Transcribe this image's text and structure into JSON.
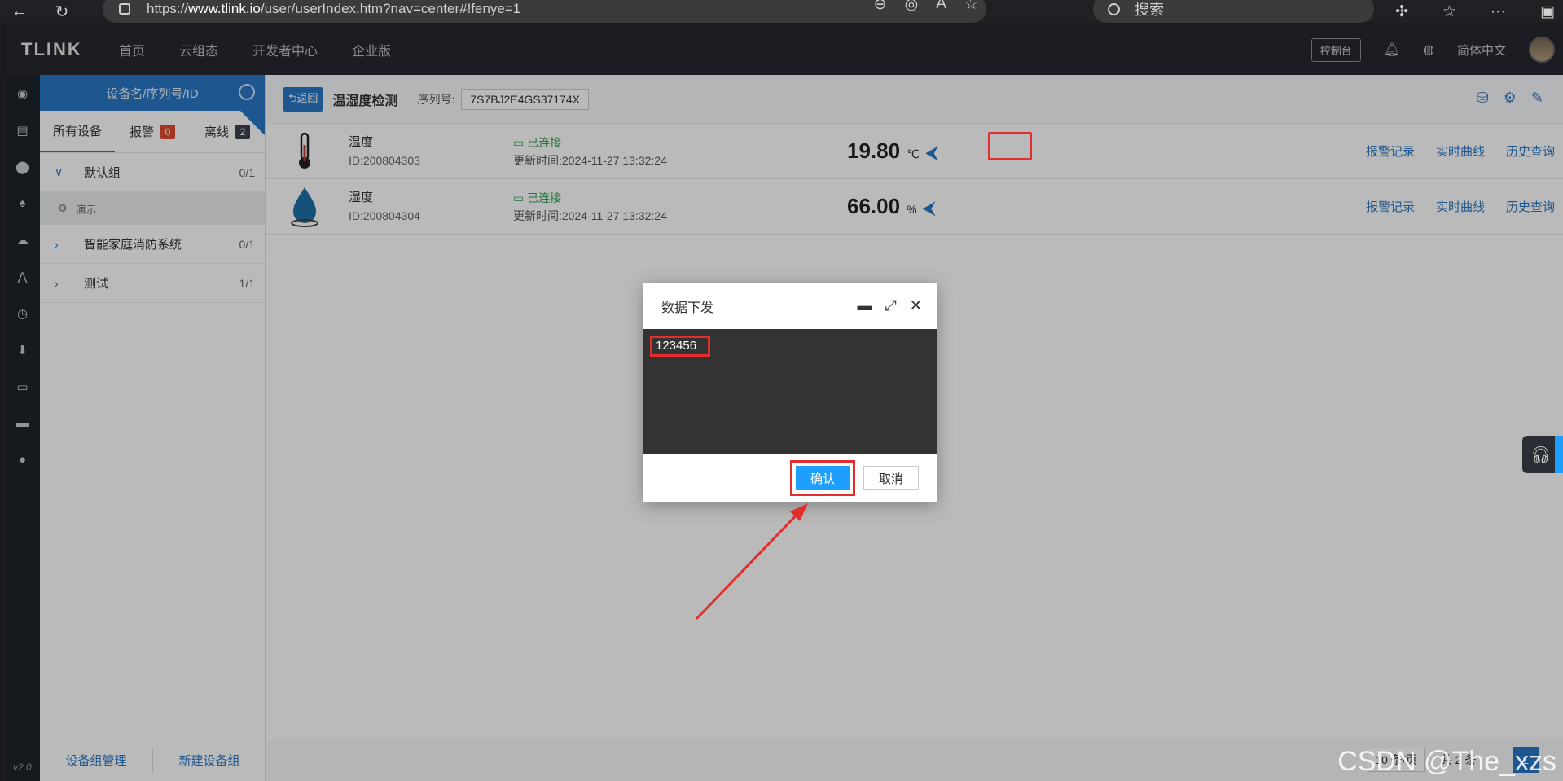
{
  "browser": {
    "url_prefix": "https://",
    "url_domain": "www.tlink.io",
    "url_path": "/user/userIndex.htm?nav=center#!fenye=1",
    "search_placeholder": "搜索"
  },
  "topnav": {
    "logo": "TLINK",
    "links": [
      "首页",
      "云组态",
      "开发者中心",
      "企业版"
    ],
    "console": "控制台",
    "language": "简体中文"
  },
  "iconbar": {
    "version": "v2.0"
  },
  "sidebar": {
    "search_placeholder": "设备名/序列号/ID",
    "tabs": [
      {
        "label": "所有设备"
      },
      {
        "label": "报警",
        "badge": "0"
      },
      {
        "label": "离线",
        "badge": "2"
      }
    ],
    "groups": [
      {
        "name": "默认组",
        "count": "0/1",
        "expanded": true,
        "children": [
          "演示"
        ]
      },
      {
        "name": "智能家庭消防系统",
        "count": "0/1"
      },
      {
        "name": "测试",
        "count": "1/1"
      }
    ],
    "footer": {
      "manage": "设备组管理",
      "create": "新建设备组"
    }
  },
  "device": {
    "back": "返回",
    "title": "温湿度检测",
    "sn_label": "序列号:",
    "sn_value": "7S7BJ2E4GS37174X",
    "sensors": [
      {
        "name": "温度",
        "id": "ID:200804303",
        "status": "已连接",
        "updated": "更新时间:2024-11-27 13:32:24",
        "value": "19.80",
        "unit": "℃",
        "icon": "thermometer-icon"
      },
      {
        "name": "湿度",
        "id": "ID:200804304",
        "status": "已连接",
        "updated": "更新时间:2024-11-27 13:32:24",
        "value": "66.00",
        "unit": "%",
        "icon": "water-drop-icon"
      }
    ],
    "row_links": {
      "alarm": "报警记录",
      "realtime": "实时曲线",
      "history": "历史查询"
    }
  },
  "pager": {
    "page_size": "10 条/页",
    "total": "共 2 条",
    "current": "1"
  },
  "dialog": {
    "title": "数据下发",
    "input_value": "123456",
    "confirm": "确认",
    "cancel": "取消"
  },
  "watermark": "CSDN @The_xzs",
  "colors": {
    "accent": "#2a78c4",
    "highlight": "#e32e2e",
    "confirm": "#1e9fff"
  }
}
